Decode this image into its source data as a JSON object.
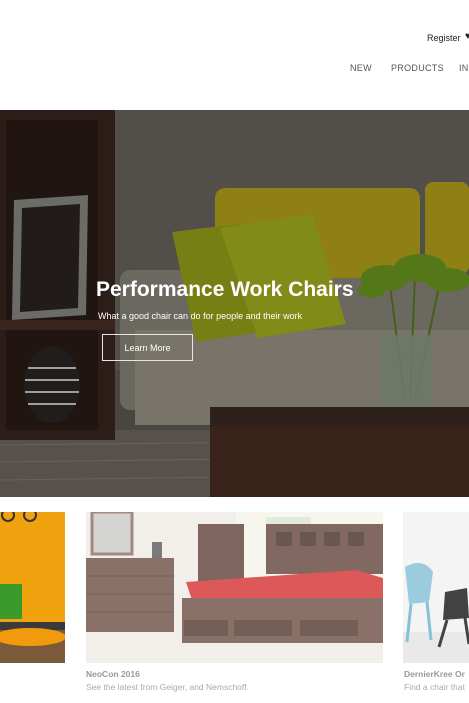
{
  "header": {
    "register_label": "Register",
    "nav": [
      "NEW",
      "PRODUCTS",
      "IN"
    ]
  },
  "hero": {
    "title": "Performance Work Chairs",
    "subtitle": "What a good chair can do for people and their work",
    "button_label": "Learn More"
  },
  "cards": [
    {
      "title": "",
      "description": ""
    },
    {
      "title": "NeoCon 2016",
      "description": "See the latest from Geiger, and Nemschoff."
    },
    {
      "title": "DernierKree Or",
      "description": "Find a chair that"
    }
  ],
  "colors": {
    "accent_yellow": "#d8c21a",
    "lime_pillow": "#b9c61c",
    "orange_wall": "#f0a20f",
    "red_bedding": "#d42a2a",
    "wood_dark": "#4a2d1f"
  }
}
